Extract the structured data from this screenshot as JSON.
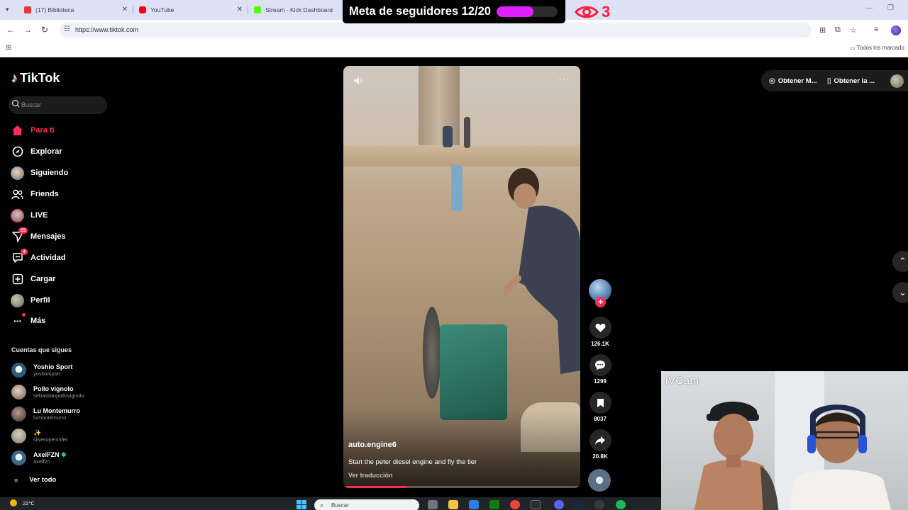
{
  "browser": {
    "tabs": [
      {
        "title": "(17) Biblioteca",
        "favicon": "youtube-library-icon",
        "color": "#e53935"
      },
      {
        "title": "YouTube",
        "favicon": "youtube-icon",
        "color": "#ff0000"
      },
      {
        "title": "Stream - Kick Dashboard",
        "favicon": "kick-icon",
        "color": "#53fc18"
      }
    ],
    "url": "https://www.tiktok.com",
    "bookmarks_all": "Todos los marcado"
  },
  "overlay": {
    "goal_label": "Meta de seguidores 12/20",
    "goal_progress": 0.6,
    "goal_color": "#e020ff",
    "viewer_count": "3",
    "viewer_color": "#ff1f3d"
  },
  "tiktok": {
    "brand": "TikTok",
    "search_placeholder": "Buscar",
    "nav": [
      {
        "label": "Para ti",
        "icon": "home-icon",
        "active": true
      },
      {
        "label": "Explorar",
        "icon": "compass-icon"
      },
      {
        "label": "Siguiendo",
        "icon": "following-avatar-icon"
      },
      {
        "label": "Friends",
        "icon": "friends-icon"
      },
      {
        "label": "LIVE",
        "icon": "live-avatar-icon"
      },
      {
        "label": "Mensajes",
        "icon": "messages-icon",
        "badge": "25"
      },
      {
        "label": "Actividad",
        "icon": "activity-icon",
        "badge": "4"
      },
      {
        "label": "Cargar",
        "icon": "upload-icon"
      },
      {
        "label": "Perfil",
        "icon": "profile-avatar-icon"
      },
      {
        "label": "Más",
        "icon": "more-dots-icon",
        "dot": true
      }
    ],
    "following_title": "Cuentas que sigues",
    "following": [
      {
        "name": "Yoshio Sport",
        "handle": "yoshiosport"
      },
      {
        "name": "Pollo vignolo",
        "handle": "sebastianpollovignolo"
      },
      {
        "name": "Lu Montemurro",
        "handle": "lumontemurro"
      },
      {
        "name": "✨",
        "handle": "silveroyennifer"
      },
      {
        "name": "AxelFZN",
        "handle": "axelfzn",
        "verified": true
      }
    ],
    "see_all": "Ver todo",
    "top_actions": [
      "Obtener M...",
      "Obtener la ..."
    ],
    "video": {
      "author": "auto.engine6",
      "description": "Start the peter diesel engine and fly the tier",
      "translate": "Ver traducción",
      "progress": 0.27,
      "likes": "126.1K",
      "comments": "1299",
      "saves": "8037",
      "shares": "20.8K"
    }
  },
  "webcam": {
    "label": "iVCam"
  },
  "taskbar": {
    "temperature": "22°C",
    "search_placeholder": "Buscar"
  }
}
